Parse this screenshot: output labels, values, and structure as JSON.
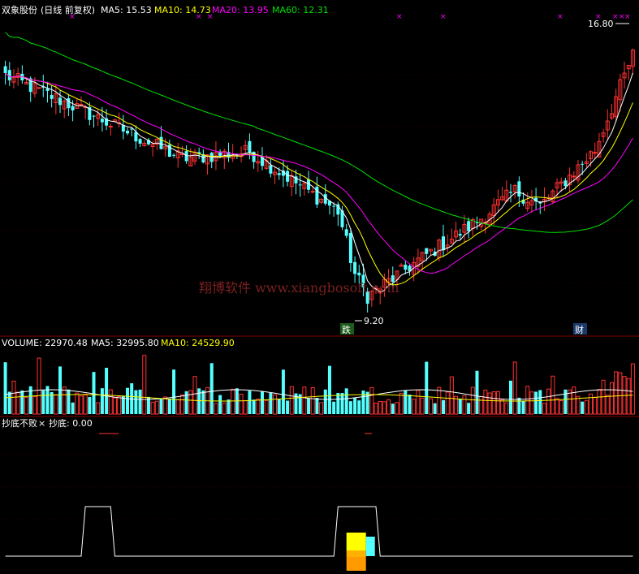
{
  "chart_data": [
    {
      "type": "candlestick",
      "panel": "price",
      "title": {
        "name": "双象股份",
        "period": "(日线 前复权)"
      },
      "indicators": [
        {
          "name": "MA5",
          "label": "MA5: 15.53",
          "color": "#ffffff"
        },
        {
          "name": "MA10",
          "label": "MA10: 14.73",
          "color": "#ffff00"
        },
        {
          "name": "MA20",
          "label": "MA20: 13.95",
          "color": "#ff00ff"
        },
        {
          "name": "MA60",
          "label": "MA60: 12.31",
          "color": "#00e000"
        }
      ],
      "annotations": {
        "high": "16.80",
        "low": "9.20",
        "badge_down": "跌",
        "badge_cai": "财"
      },
      "watermark": "翔博软件 www.xiangbosoft.com",
      "y_range": [
        8.75,
        17.35
      ],
      "candle_count": 150,
      "key_points": [
        {
          "index": 0,
          "price": 15.8
        },
        {
          "index": 16,
          "price": 14.9
        },
        {
          "index": 42,
          "price": 13.35
        },
        {
          "index": 58,
          "price": 13.55
        },
        {
          "index": 79,
          "price": 11.8
        },
        {
          "index": 83,
          "price": 9.95
        },
        {
          "index": 86,
          "price": 9.3
        },
        {
          "index": 98,
          "price": 10.35
        },
        {
          "index": 112,
          "price": 11.5
        },
        {
          "index": 121,
          "price": 12.4
        },
        {
          "index": 127,
          "price": 11.95
        },
        {
          "index": 140,
          "price": 13.6
        },
        {
          "index": 149,
          "price": 16.4
        }
      ],
      "ma_colors": {
        "ma5": "#ffffff",
        "ma10": "#ffff00",
        "ma20": "#ff00ff",
        "ma60": "#00e000"
      }
    },
    {
      "type": "bar",
      "panel": "volume",
      "title": "VOLUME",
      "indicators": [
        {
          "name": "VOLUME",
          "label": "VOLUME: 22970.48",
          "color": "#ffffff"
        },
        {
          "name": "MA5",
          "label": "MA5: 32995.80",
          "color": "#ffffff"
        },
        {
          "name": "MA10",
          "label": "MA10: 24529.90",
          "color": "#ffff00"
        }
      ],
      "y_range": [
        0,
        50000
      ],
      "colors": {
        "up": "#ff3232",
        "down": "#54ffff"
      }
    },
    {
      "type": "line",
      "panel": "indicator",
      "title": "抄底不败",
      "indicators": [
        {
          "name": "抄底不败",
          "label": "抄底不败",
          "color": "#ffffff"
        },
        {
          "name": "抄底",
          "label": "抄底: 0.00",
          "color": "#ffffff"
        }
      ],
      "signal_windows": [
        {
          "start_index": 19,
          "end_index": 25,
          "value": 1
        },
        {
          "start_index": 79,
          "end_index": 88,
          "value": 1
        }
      ],
      "y_range": [
        0,
        1.2
      ]
    }
  ]
}
